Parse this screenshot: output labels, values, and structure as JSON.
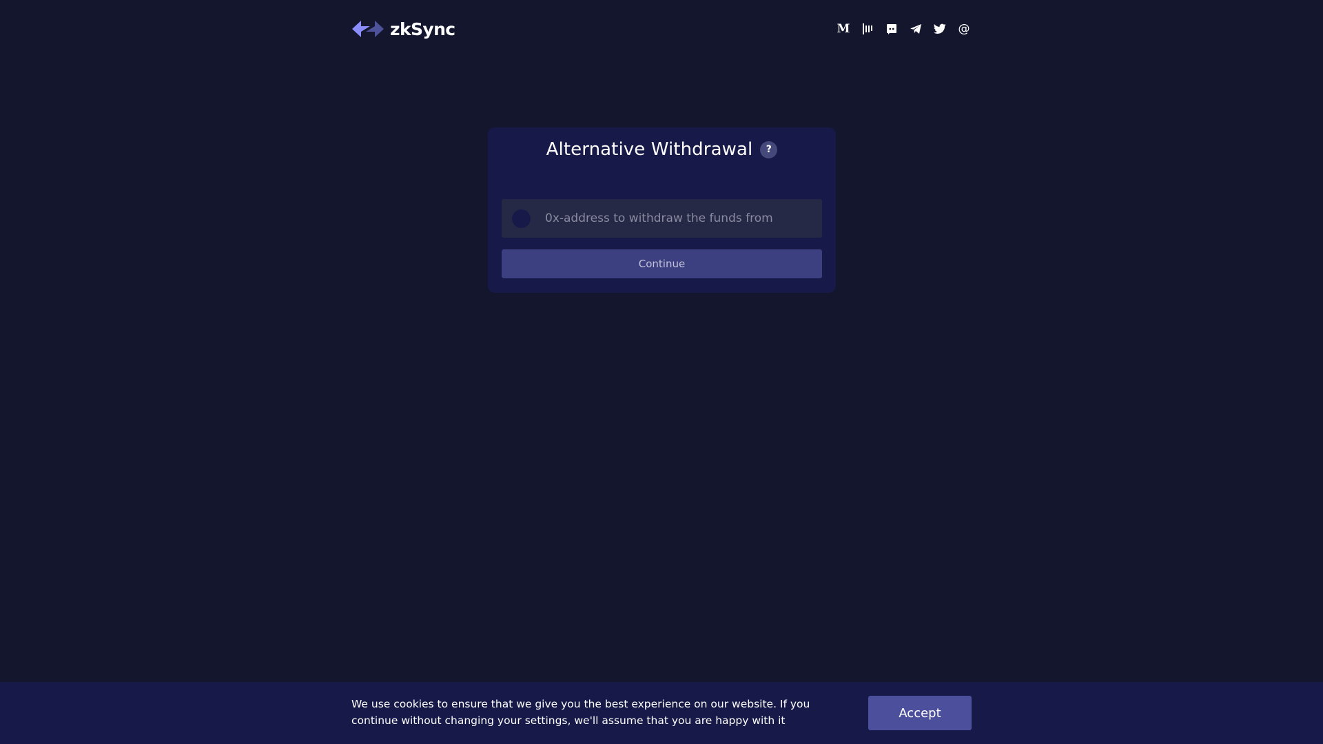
{
  "header": {
    "logo_text": "zkSync",
    "social_links": [
      {
        "icon": "medium-icon",
        "glyph": "M"
      },
      {
        "icon": "gitcoin-icon"
      },
      {
        "icon": "discord-icon"
      },
      {
        "icon": "telegram-icon"
      },
      {
        "icon": "twitter-icon"
      },
      {
        "icon": "email-icon",
        "glyph": "@"
      }
    ]
  },
  "card": {
    "title": "Alternative Withdrawal",
    "help_badge": "?",
    "address_placeholder": "0x-address to withdraw the funds from",
    "continue_label": "Continue"
  },
  "cookie": {
    "text": "We use cookies to ensure that we give you the best experience on our website. If you continue without changing your settings, we'll assume that you are happy with it",
    "accept_label": "Accept"
  },
  "colors": {
    "background": "#13162c",
    "card": "#171a48",
    "input": "#262946",
    "button": "#3d4080",
    "accept": "#4c4f9c",
    "logo_accent": "#8c8dfc"
  }
}
